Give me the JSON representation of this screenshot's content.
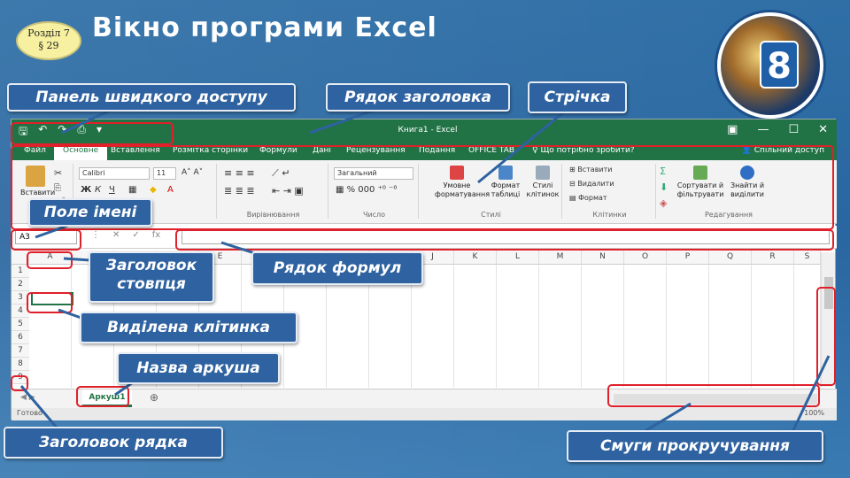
{
  "slide": {
    "section_line1": "Розділ 7",
    "section_line2": "§ 29",
    "title": "Вікно програми Excel",
    "logo_number": "8"
  },
  "callouts": {
    "qat": "Панель швидкого доступу",
    "titlebar": "Рядок заголовка",
    "ribbon": "Стрічка",
    "namebox": "Поле імені",
    "colheader": "Заголовок стовпця",
    "formulabar": "Рядок формул",
    "selcell": "Виділена клітинка",
    "sheetname": "Назва аркуша",
    "rowheader": "Заголовок рядка",
    "scrollbars": "Смуги прокручування"
  },
  "excel": {
    "window_title": "Книга1 - Excel",
    "tabs": [
      "Файл",
      "Основне",
      "Вставлення",
      "Розмітка сторінки",
      "Формули",
      "Дані",
      "Рецензування",
      "Подання",
      "OFFICE TAB",
      "♀ Що потрібно зробити?"
    ],
    "share": "Спільний доступ",
    "ribbon": {
      "paste": "Вставити",
      "font_name": "Calibri",
      "font_size": "11",
      "number_format": "Загальний",
      "alignment_label": "Вирівнювання",
      "number_label": "Число",
      "cond_format": "Умовне форматування",
      "format_table": "Формат таблиці",
      "cell_styles": "Стилі клітинок",
      "styles_label": "Стилі",
      "insert": "Вставити",
      "delete": "Видалити",
      "format": "Формат",
      "cells_label": "Клітинки",
      "sort": "Сортувати й фільтрувати",
      "find": "Знайти й виділити",
      "editing_label": "Редагування"
    },
    "name_box": "A3",
    "fx": "fx",
    "columns": [
      "A",
      "B",
      "C",
      "D",
      "E",
      "F",
      "G",
      "H",
      "I",
      "J",
      "K",
      "L",
      "M",
      "N",
      "O",
      "P",
      "Q",
      "R",
      "S"
    ],
    "rows": [
      "1",
      "2",
      "3",
      "4",
      "5",
      "6",
      "7",
      "8",
      "9"
    ],
    "sheet_tab": "Аркуш1",
    "status_left": "Готово",
    "zoom": "100%"
  },
  "colors": {
    "excel_green": "#217346",
    "callout_bg": "#2e62a0",
    "highlight": "#e0202a"
  }
}
